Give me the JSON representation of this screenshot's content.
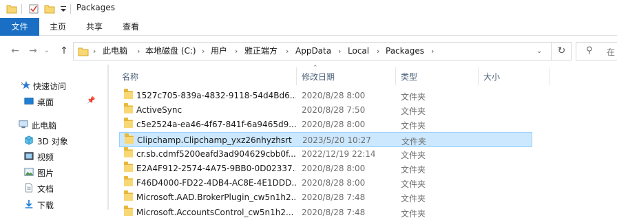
{
  "window": {
    "title": "Packages"
  },
  "ribbon": {
    "tabs": [
      "文件",
      "主页",
      "共享",
      "查看"
    ]
  },
  "address": {
    "crumbs": [
      "此电脑",
      "本地磁盘 (C:)",
      "用户",
      "雅正端方",
      "AppData",
      "Local",
      "Packages"
    ],
    "search_placeholder": "在"
  },
  "nav": {
    "items": [
      {
        "label": "快速访问",
        "icon": "star-icon"
      },
      {
        "label": "桌面",
        "icon": "desktop-icon"
      },
      {
        "label": "此电脑",
        "icon": "computer-icon"
      },
      {
        "label": "3D 对象",
        "icon": "cube-icon"
      },
      {
        "label": "视频",
        "icon": "video-icon"
      },
      {
        "label": "图片",
        "icon": "picture-icon"
      },
      {
        "label": "文档",
        "icon": "document-icon"
      },
      {
        "label": "下载",
        "icon": "download-icon"
      }
    ]
  },
  "columns": {
    "name": "名称",
    "date": "修改日期",
    "type": "类型",
    "size": "大小"
  },
  "files": [
    {
      "name": "1527c705-839a-4832-9118-54d4Bd6...",
      "date": "2020/8/28 8:00",
      "type": "文件夹"
    },
    {
      "name": "ActiveSync",
      "date": "2020/8/28 7:50",
      "type": "文件夹"
    },
    {
      "name": "c5e2524a-ea46-4f67-841f-6a9465d9...",
      "date": "2020/8/28 8:00",
      "type": "文件夹"
    },
    {
      "name": "Clipchamp.Clipchamp_yxz26nhyzhsrt",
      "date": "2023/5/20 10:27",
      "type": "文件夹",
      "selected": true
    },
    {
      "name": "cr.sb.cdmf5200eafd3ad904629cbb0f...",
      "date": "2022/12/19 22:14",
      "type": "文件夹"
    },
    {
      "name": "E2A4F912-2574-4A75-9BB0-0D02337...",
      "date": "2020/8/28 8:00",
      "type": "文件夹"
    },
    {
      "name": "F46D4000-FD22-4DB4-AC8E-4E1DDD...",
      "date": "2020/8/28 8:00",
      "type": "文件夹"
    },
    {
      "name": "Microsoft.AAD.BrokerPlugin_cw5n1h2...",
      "date": "2020/8/28 7:48",
      "type": "文件夹"
    },
    {
      "name": "Microsoft.AccountsControl_cw5n1h2...",
      "date": "2020/8/28 7:48",
      "type": "文件夹"
    }
  ],
  "colors": {
    "accent": "#1a6fc4",
    "selection": "#cce8ff",
    "folder": "#f8d775"
  }
}
